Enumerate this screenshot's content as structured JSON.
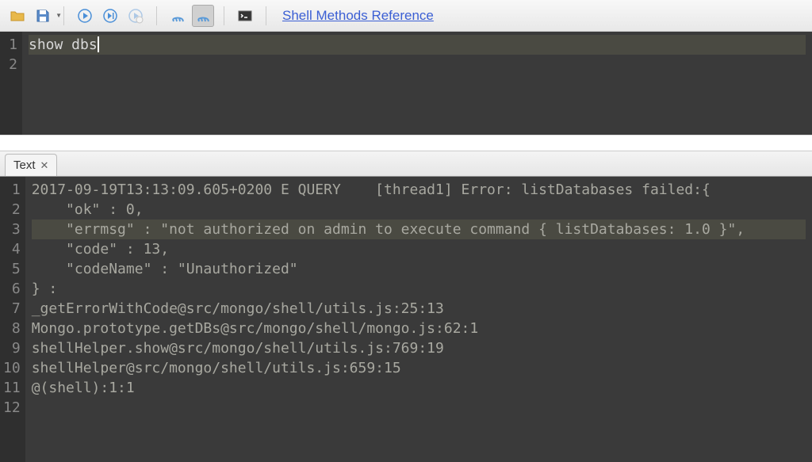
{
  "toolbar": {
    "ref_link": "Shell Methods Reference"
  },
  "editor": {
    "lines": [
      "1",
      "2"
    ],
    "text": "show dbs"
  },
  "tabs": {
    "text_label": "Text",
    "close_glyph": "✕"
  },
  "output": {
    "gutter": [
      "1",
      "2",
      "3",
      "4",
      "5",
      "6",
      "7",
      "8",
      "9",
      "10",
      "11",
      "12"
    ],
    "lines": [
      "2017-09-19T13:13:09.605+0200 E QUERY    [thread1] Error: listDatabases failed:{",
      "    \"ok\" : 0,",
      "    \"errmsg\" : \"not authorized on admin to execute command { listDatabases: 1.0 }\",",
      "    \"code\" : 13,",
      "    \"codeName\" : \"Unauthorized\"",
      "} :",
      "_getErrorWithCode@src/mongo/shell/utils.js:25:13",
      "Mongo.prototype.getDBs@src/mongo/shell/mongo.js:62:1",
      "shellHelper.show@src/mongo/shell/utils.js:769:19",
      "shellHelper@src/mongo/shell/utils.js:659:15",
      "@(shell):1:1",
      ""
    ],
    "highlight_index": 2
  }
}
